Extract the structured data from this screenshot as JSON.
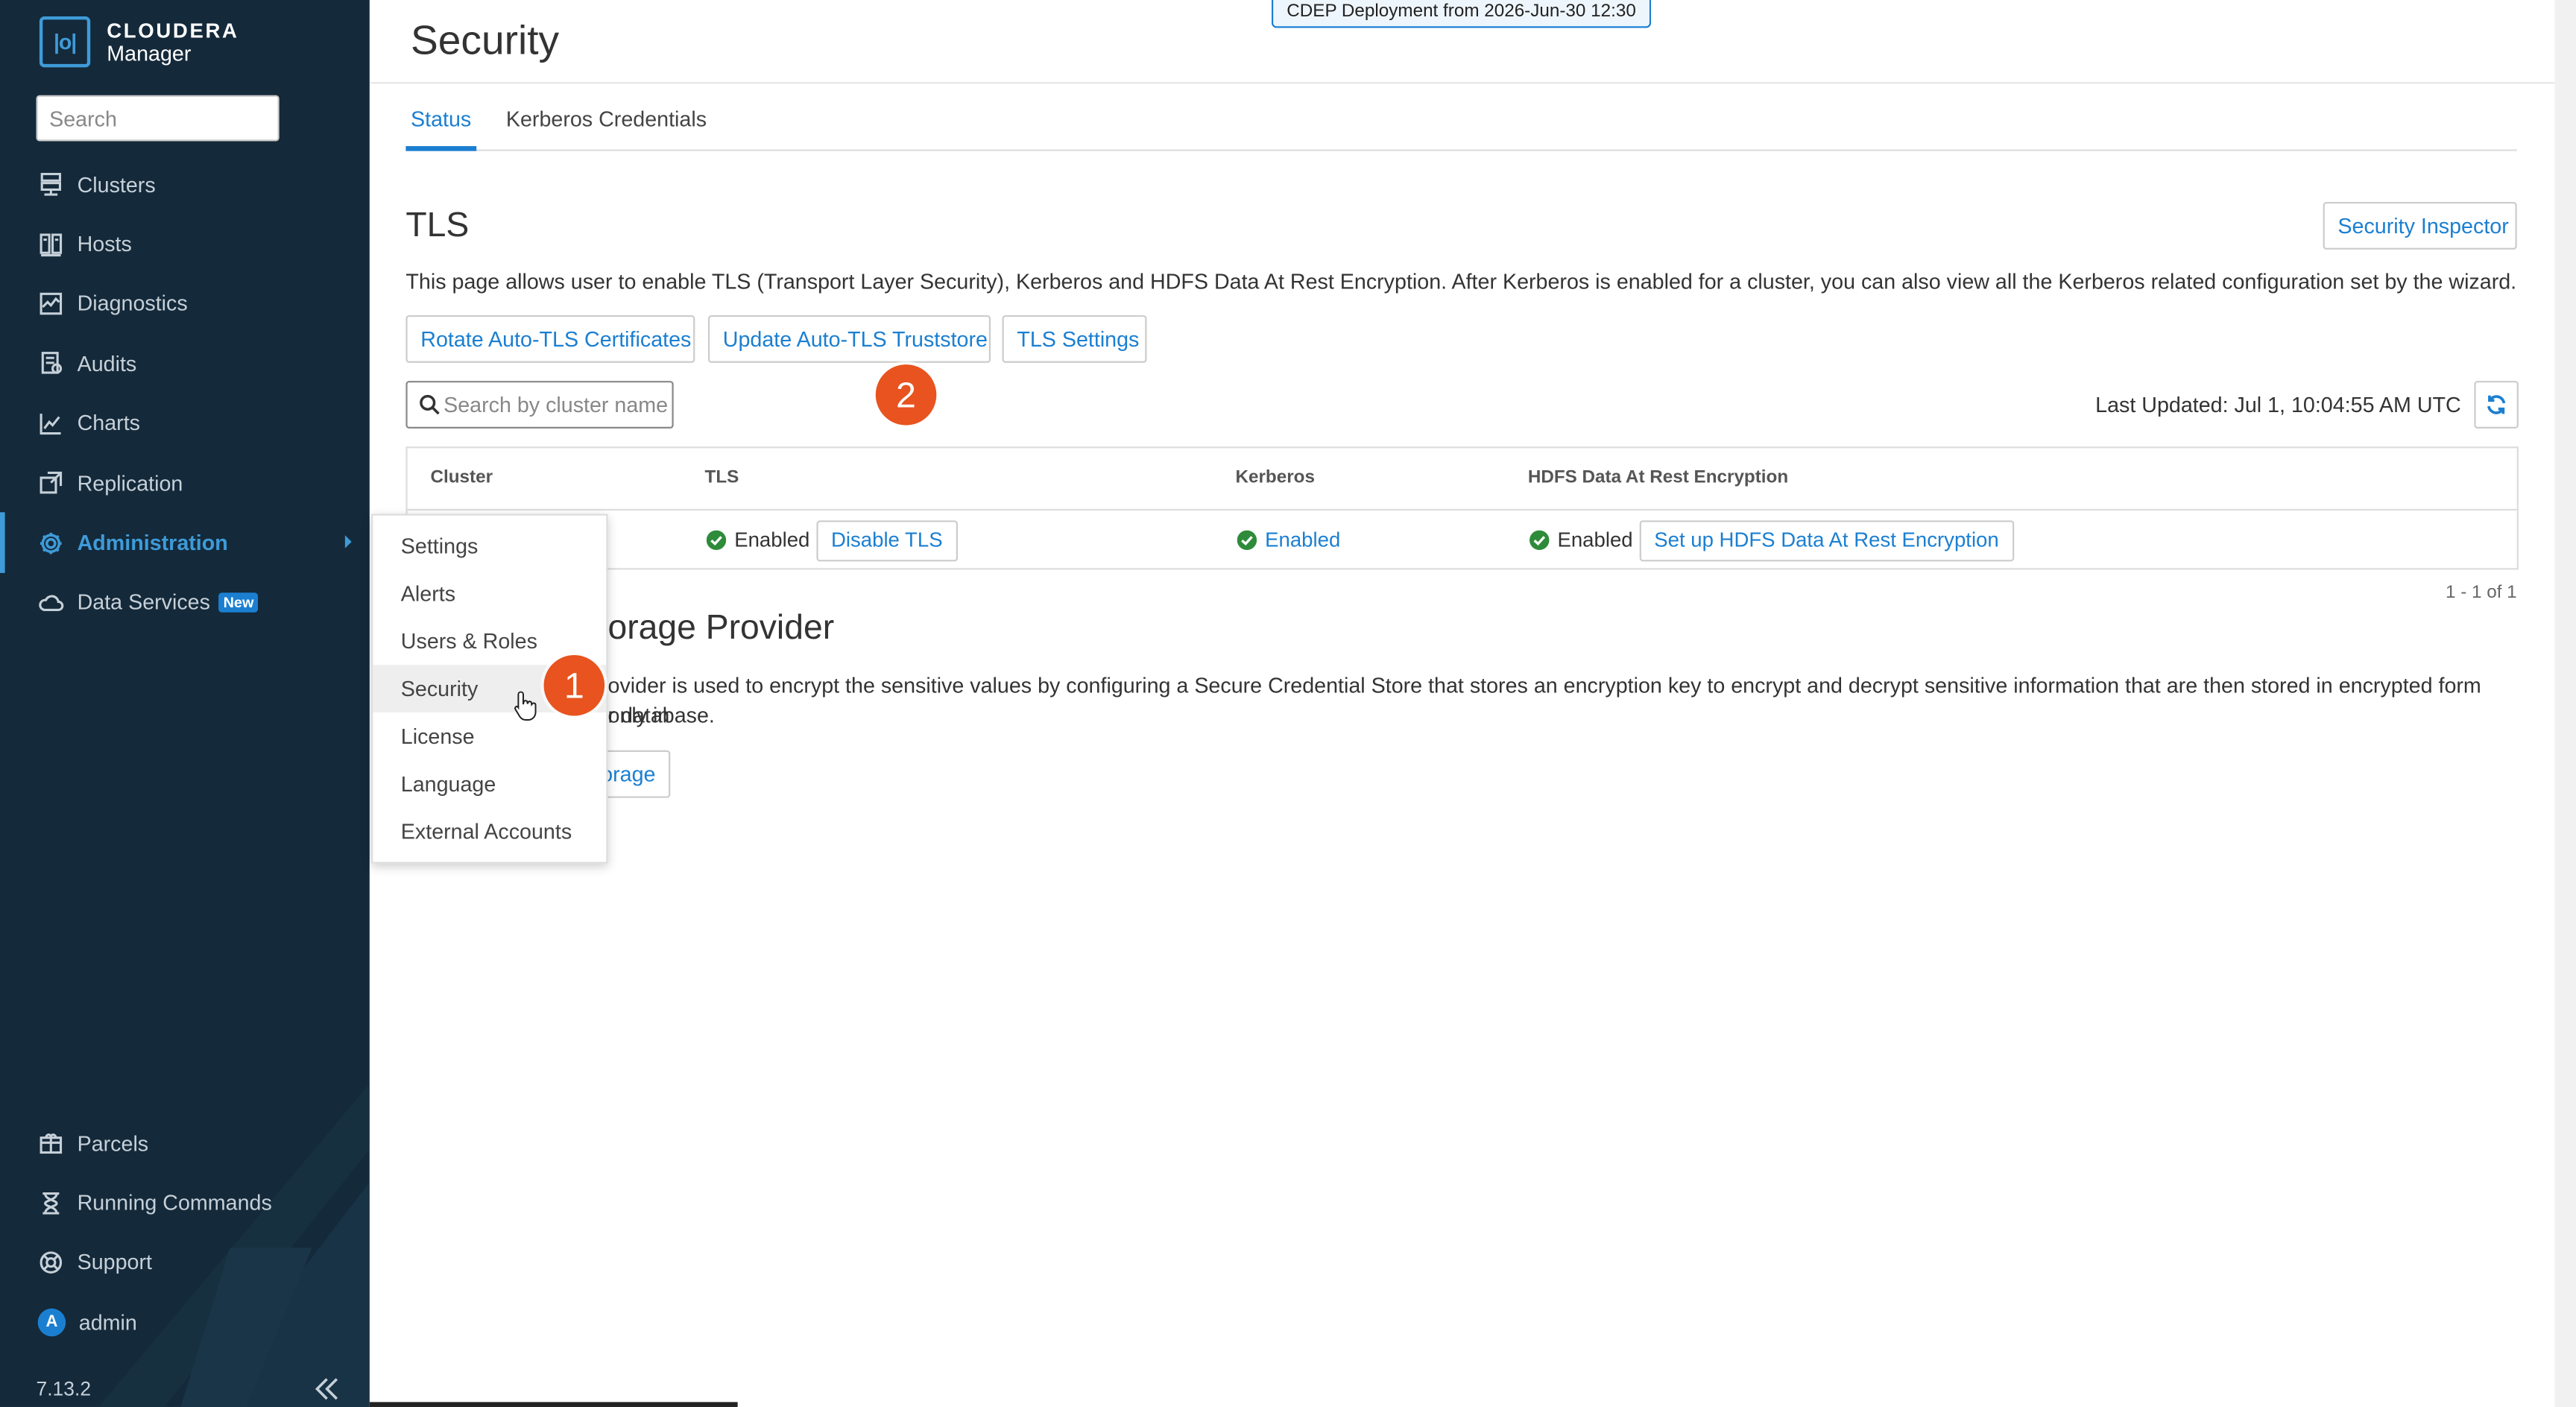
{
  "app": {
    "brand_line1": "CLOUDERA",
    "brand_line2": "Manager",
    "logo_mark": "|o|",
    "version": "7.13.2",
    "accent": "#1b7fd1"
  },
  "sidebar": {
    "search_placeholder": "Search",
    "items": [
      {
        "label": "Clusters",
        "icon": "server-icon"
      },
      {
        "label": "Hosts",
        "icon": "hosts-icon"
      },
      {
        "label": "Diagnostics",
        "icon": "diagnostics-icon"
      },
      {
        "label": "Audits",
        "icon": "audits-icon"
      },
      {
        "label": "Charts",
        "icon": "charts-icon"
      },
      {
        "label": "Replication",
        "icon": "replication-icon"
      },
      {
        "label": "Administration",
        "icon": "gear-icon"
      },
      {
        "label": "Data Services",
        "icon": "cloud-icon",
        "badge": "New"
      }
    ],
    "bottom_items": [
      {
        "label": "Parcels",
        "icon": "parcel-icon"
      },
      {
        "label": "Running Commands",
        "icon": "hourglass-icon"
      },
      {
        "label": "Support",
        "icon": "lifebuoy-icon"
      },
      {
        "label": "admin",
        "avatar": "A"
      }
    ]
  },
  "header": {
    "title": "Security",
    "deployment_banner": "CDEP Deployment from 2026-Jun-30 12:30"
  },
  "tabs": [
    {
      "label": "Status",
      "active": true
    },
    {
      "label": "Kerberos Credentials",
      "active": false
    }
  ],
  "tls": {
    "heading": "TLS",
    "security_inspector": "Security Inspector",
    "description": "This page allows user to enable TLS (Transport Layer Security), Kerberos and HDFS Data At Rest Encryption. After Kerberos is enabled for a cluster, you can also view all the Kerberos related configuration set by the wizard.",
    "buttons": {
      "rotate": "Rotate Auto-TLS Certificates",
      "update": "Update Auto-TLS Truststore",
      "settings": "TLS Settings"
    },
    "search_placeholder": "Search by cluster name",
    "last_updated": "Last Updated: Jul 1, 10:04:55 AM UTC"
  },
  "table": {
    "headers": {
      "cluster": "Cluster",
      "tls": "TLS",
      "kerberos": "Kerberos",
      "hdfs": "HDFS Data At Rest Encryption"
    },
    "row": {
      "tls_status": "Enabled",
      "tls_action": "Disable TLS",
      "kerberos_status": "Enabled",
      "hdfs_status": "Enabled",
      "hdfs_action": "Set up HDFS Data At Rest Encryption"
    },
    "pager": "1 - 1 of 1"
  },
  "storage": {
    "heading_partial": "orage Provider",
    "description_line1": "ovider is used to encrypt the sensitive values by configuring a Secure Credential Store that stores an encryption key to encrypt and decrypt sensitive information that are then stored in encrypted form only in",
    "description_line2": "r database.",
    "button_partial": "orage"
  },
  "admin_menu": {
    "items": [
      "Settings",
      "Alerts",
      "Users & Roles",
      "Security",
      "License",
      "Language",
      "External Accounts"
    ],
    "hovered": "Security"
  },
  "markers": {
    "step1": "1",
    "step2": "2"
  }
}
